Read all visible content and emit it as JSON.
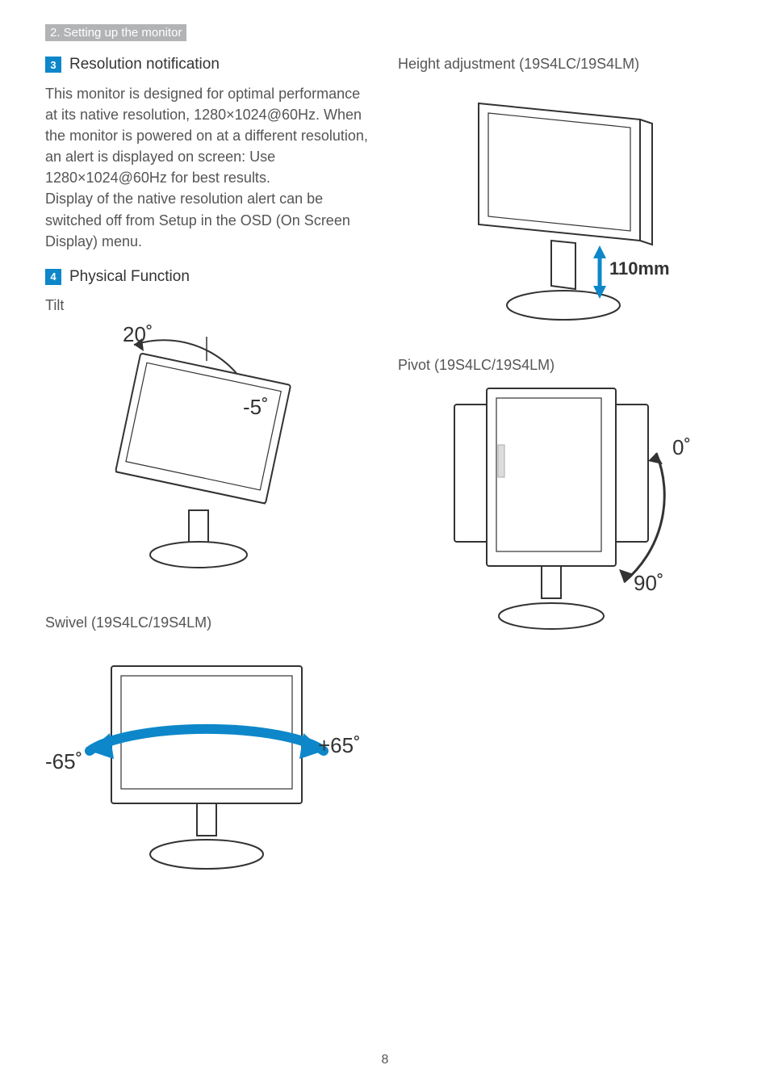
{
  "header": "2. Setting up the monitor",
  "page_number": "8",
  "sections": {
    "s3": {
      "num": "3",
      "title": "Resolution notification"
    },
    "s4": {
      "num": "4",
      "title": "Physical Function"
    }
  },
  "paragraphs": {
    "resolution": "This monitor is designed for optimal performance at its native resolution, 1280×1024@60Hz. When the monitor is powered on at a different resolution, an alert is displayed on screen: Use 1280×1024@60Hz for best results.\nDisplay of the native resolution alert can be switched off from Setup in the OSD (On Screen Display) menu."
  },
  "labels": {
    "tilt": "Tilt",
    "swivel": "Swivel (19S4LC/19S4LM)",
    "height": "Height adjustment (19S4LC/19S4LM)",
    "pivot": "Pivot (19S4LC/19S4LM)"
  },
  "annotations": {
    "tilt_back": "20˚",
    "tilt_fwd": "-5˚",
    "swivel_left": "-65˚",
    "swivel_right": "+65˚",
    "height_val": "110mm",
    "pivot_top": "0˚",
    "pivot_bottom": "90˚"
  }
}
